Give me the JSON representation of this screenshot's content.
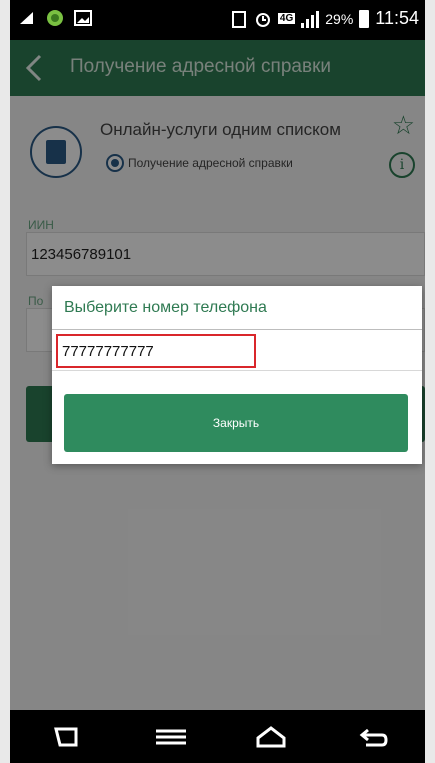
{
  "status_bar": {
    "battery_percent": "29%",
    "time": "11:54",
    "network_badge": "4G",
    "icons": [
      "sim-card-icon",
      "alarm-icon",
      "signal-icon",
      "battery-icon",
      "wifi-app-icon",
      "image-icon"
    ]
  },
  "header": {
    "title": "Получение адресной справки",
    "back_icon": "chevron-left-icon"
  },
  "service_card": {
    "title": "Онлайн-услуги одним списком",
    "subtitle": "Получение адресной справки",
    "favorite_icon": "star-outline-icon",
    "info_icon": "info-icon",
    "info_glyph": "i"
  },
  "form": {
    "iin_label": "ИИН",
    "iin_value": "123456789101",
    "phone_label_partial": "По",
    "phone_value": ""
  },
  "dialog": {
    "title": "Выберите номер телефона",
    "phone_option": "77777777777",
    "close_button": "Закрыть"
  },
  "nav_bar": {
    "icons": [
      "recent-apps-icon",
      "menu-icon",
      "home-icon",
      "back-icon"
    ]
  },
  "colors": {
    "primary": "#2f7a52",
    "accent_button": "#2f8b5e",
    "highlight_border": "#d9262b",
    "icon_blue": "#2a5a86"
  }
}
